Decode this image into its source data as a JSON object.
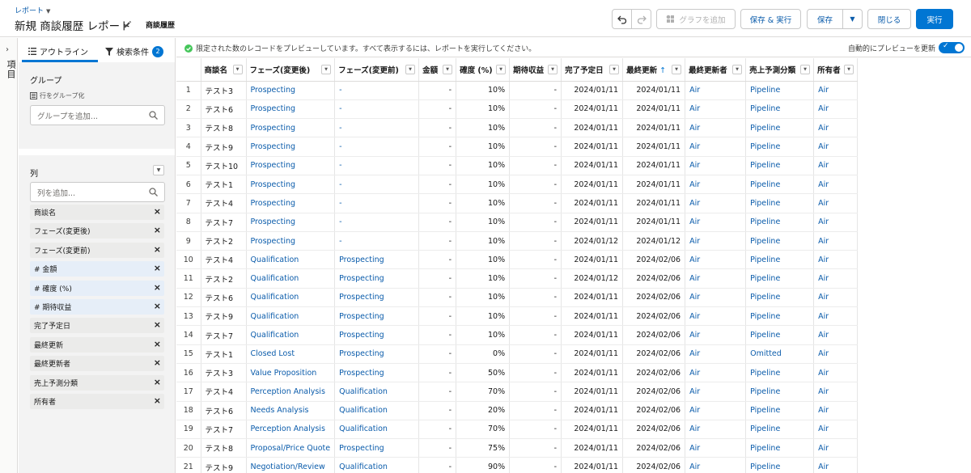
{
  "header": {
    "breadcrumb": "レポート",
    "title": "新規 商談履歴 レポート",
    "report_type": "商談履歴",
    "buttons": {
      "add_chart": "グラフを追加",
      "save_run": "保存 & 実行",
      "save": "保存",
      "close": "閉じる",
      "run": "実行"
    }
  },
  "side_rail": {
    "label": "項目"
  },
  "left_panel": {
    "tabs": {
      "outline": "アウトライン",
      "filters": "検索条件",
      "filters_count": "2"
    },
    "groups": {
      "heading": "グループ",
      "group_rows_label": "行をグループ化",
      "placeholder": "グループを追加..."
    },
    "columns": {
      "heading": "列",
      "placeholder": "列を追加...",
      "items": [
        {
          "label": "商談名"
        },
        {
          "label": "フェーズ(変更後)"
        },
        {
          "label": "フェーズ(変更前)"
        },
        {
          "label": "# 金額"
        },
        {
          "label": "# 確度 (%)"
        },
        {
          "label": "# 期待収益"
        },
        {
          "label": "完了予定日"
        },
        {
          "label": "最終更新"
        },
        {
          "label": "最終更新者"
        },
        {
          "label": "売上予測分類"
        },
        {
          "label": "所有者"
        }
      ]
    }
  },
  "preview_bar": {
    "message": "限定された数のレコードをプレビューしています。すべて表示するには、レポートを実行してください。",
    "auto_update": "自動的にプレビューを更新"
  },
  "table": {
    "headers": [
      "商談名",
      "フェーズ(変更後)",
      "フェーズ(変更前)",
      "金額",
      "確度 (%)",
      "期待収益",
      "完了予定日",
      "最終更新",
      "最終更新者",
      "売上予測分類",
      "所有者"
    ],
    "sort_indicator": "↑",
    "rows": [
      [
        "1",
        "テスト3",
        "Prospecting",
        "-",
        "-",
        "10%",
        "-",
        "2024/01/11",
        "2024/01/11",
        "Air",
        "Pipeline",
        "Air"
      ],
      [
        "2",
        "テスト6",
        "Prospecting",
        "-",
        "-",
        "10%",
        "-",
        "2024/01/11",
        "2024/01/11",
        "Air",
        "Pipeline",
        "Air"
      ],
      [
        "3",
        "テスト8",
        "Prospecting",
        "-",
        "-",
        "10%",
        "-",
        "2024/01/11",
        "2024/01/11",
        "Air",
        "Pipeline",
        "Air"
      ],
      [
        "4",
        "テスト9",
        "Prospecting",
        "-",
        "-",
        "10%",
        "-",
        "2024/01/11",
        "2024/01/11",
        "Air",
        "Pipeline",
        "Air"
      ],
      [
        "5",
        "テスト10",
        "Prospecting",
        "-",
        "-",
        "10%",
        "-",
        "2024/01/11",
        "2024/01/11",
        "Air",
        "Pipeline",
        "Air"
      ],
      [
        "6",
        "テスト1",
        "Prospecting",
        "-",
        "-",
        "10%",
        "-",
        "2024/01/11",
        "2024/01/11",
        "Air",
        "Pipeline",
        "Air"
      ],
      [
        "7",
        "テスト4",
        "Prospecting",
        "-",
        "-",
        "10%",
        "-",
        "2024/01/11",
        "2024/01/11",
        "Air",
        "Pipeline",
        "Air"
      ],
      [
        "8",
        "テスト7",
        "Prospecting",
        "-",
        "-",
        "10%",
        "-",
        "2024/01/11",
        "2024/01/11",
        "Air",
        "Pipeline",
        "Air"
      ],
      [
        "9",
        "テスト2",
        "Prospecting",
        "-",
        "-",
        "10%",
        "-",
        "2024/01/12",
        "2024/01/12",
        "Air",
        "Pipeline",
        "Air"
      ],
      [
        "10",
        "テスト4",
        "Qualification",
        "Prospecting",
        "-",
        "10%",
        "-",
        "2024/01/11",
        "2024/02/06",
        "Air",
        "Pipeline",
        "Air"
      ],
      [
        "11",
        "テスト2",
        "Qualification",
        "Prospecting",
        "-",
        "10%",
        "-",
        "2024/01/12",
        "2024/02/06",
        "Air",
        "Pipeline",
        "Air"
      ],
      [
        "12",
        "テスト6",
        "Qualification",
        "Prospecting",
        "-",
        "10%",
        "-",
        "2024/01/11",
        "2024/02/06",
        "Air",
        "Pipeline",
        "Air"
      ],
      [
        "13",
        "テスト9",
        "Qualification",
        "Prospecting",
        "-",
        "10%",
        "-",
        "2024/01/11",
        "2024/02/06",
        "Air",
        "Pipeline",
        "Air"
      ],
      [
        "14",
        "テスト7",
        "Qualification",
        "Prospecting",
        "-",
        "10%",
        "-",
        "2024/01/11",
        "2024/02/06",
        "Air",
        "Pipeline",
        "Air"
      ],
      [
        "15",
        "テスト1",
        "Closed Lost",
        "Prospecting",
        "-",
        "0%",
        "-",
        "2024/01/11",
        "2024/02/06",
        "Air",
        "Omitted",
        "Air"
      ],
      [
        "16",
        "テスト3",
        "Value Proposition",
        "Prospecting",
        "-",
        "50%",
        "-",
        "2024/01/11",
        "2024/02/06",
        "Air",
        "Pipeline",
        "Air"
      ],
      [
        "17",
        "テスト4",
        "Perception Analysis",
        "Qualification",
        "-",
        "70%",
        "-",
        "2024/01/11",
        "2024/02/06",
        "Air",
        "Pipeline",
        "Air"
      ],
      [
        "18",
        "テスト6",
        "Needs Analysis",
        "Qualification",
        "-",
        "20%",
        "-",
        "2024/01/11",
        "2024/02/06",
        "Air",
        "Pipeline",
        "Air"
      ],
      [
        "19",
        "テスト7",
        "Perception Analysis",
        "Qualification",
        "-",
        "70%",
        "-",
        "2024/01/11",
        "2024/02/06",
        "Air",
        "Pipeline",
        "Air"
      ],
      [
        "20",
        "テスト8",
        "Proposal/Price Quote",
        "Prospecting",
        "-",
        "75%",
        "-",
        "2024/01/11",
        "2024/02/06",
        "Air",
        "Pipeline",
        "Air"
      ],
      [
        "21",
        "テスト9",
        "Negotiation/Review",
        "Qualification",
        "-",
        "90%",
        "-",
        "2024/01/11",
        "2024/02/06",
        "Air",
        "Pipeline",
        "Air"
      ]
    ]
  },
  "colors": {
    "brand": "#0176d3",
    "link": "#0b5cab",
    "border": "#dddbda"
  },
  "icons": [
    "chevron-down-icon",
    "pencil-icon",
    "undo-icon",
    "redo-icon",
    "chart-icon",
    "list-icon",
    "filter-icon",
    "search-icon",
    "close-icon",
    "check-circle-icon",
    "toggle-check-icon",
    "chevron-right-icon",
    "group-rows-icon"
  ]
}
